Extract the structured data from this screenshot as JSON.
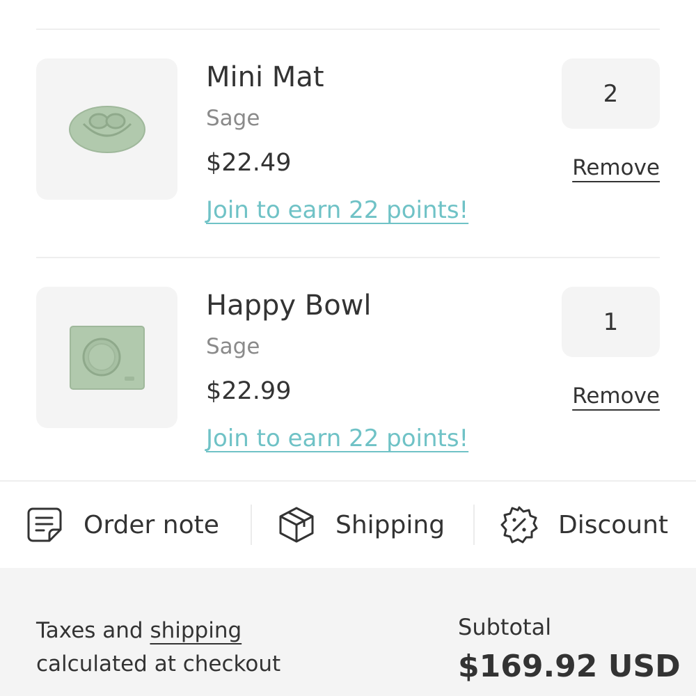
{
  "cart": {
    "items": [
      {
        "name": "Mini Mat",
        "variant": "Sage",
        "price": "$22.49",
        "points_text": "Join to earn 22 points!",
        "quantity": "2",
        "remove_label": "Remove",
        "image_icon": "mini-mat-product-image"
      },
      {
        "name": "Happy Bowl",
        "variant": "Sage",
        "price": "$22.99",
        "points_text": "Join to earn 22 points!",
        "quantity": "1",
        "remove_label": "Remove",
        "image_icon": "happy-bowl-product-image"
      }
    ]
  },
  "actions": {
    "order_note": {
      "label": "Order note",
      "icon": "note-icon"
    },
    "shipping": {
      "label": "Shipping",
      "icon": "box-icon"
    },
    "discount": {
      "label": "Discount",
      "icon": "discount-badge-icon"
    }
  },
  "footer": {
    "taxes_prefix": "Taxes and",
    "taxes_link": "shipping",
    "taxes_suffix": "calculated at checkout",
    "subtotal_label": "Subtotal",
    "subtotal_value": "$169.92 USD"
  },
  "colors": {
    "accent_link": "#6fc2c6",
    "product_sage": "#a9c4a5",
    "panel_bg": "#f4f4f4",
    "text": "#333333",
    "muted_text": "#8a8a8a"
  }
}
